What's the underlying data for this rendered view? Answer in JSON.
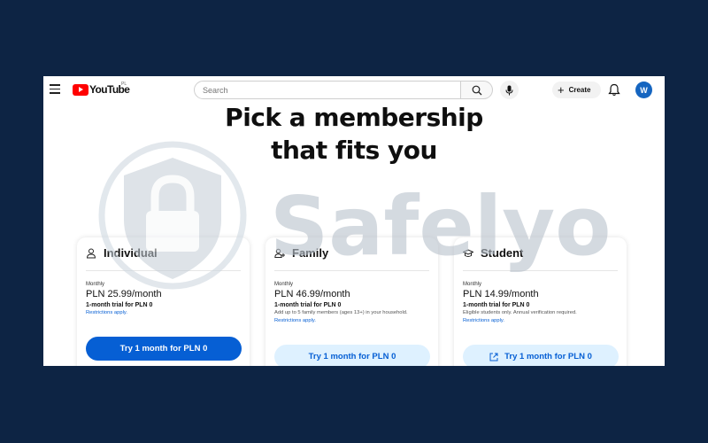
{
  "topbar": {
    "logo_text": "YouTube",
    "region": "PL",
    "search_placeholder": "Search",
    "create_label": "Create",
    "avatar_initial": "W"
  },
  "heading": {
    "line1": "Pick a membership",
    "line2": "that fits you"
  },
  "plans": [
    {
      "title": "Individual",
      "icon": "person-icon",
      "period": "Monthly",
      "price": "PLN 25.99/month",
      "trial": "1-month trial for PLN 0",
      "note": "",
      "restrictions": "Restrictions apply.",
      "button": "Try 1 month for PLN 0"
    },
    {
      "title": "Family",
      "icon": "family-icon",
      "period": "Monthly",
      "price": "PLN 46.99/month",
      "trial": "1-month trial for PLN 0",
      "note": "Add up to 5 family members (ages 13+) in your household.",
      "restrictions": "Restrictions apply.",
      "button": "Try 1 month for PLN 0"
    },
    {
      "title": "Student",
      "icon": "graduation-cap-icon",
      "period": "Monthly",
      "price": "PLN 14.99/month",
      "trial": "1-month trial for PLN 0",
      "note": "Eligible students only. Annual verification required.",
      "restrictions": "Restrictions apply.",
      "button": "Try 1 month for PLN 0"
    }
  ],
  "watermark": {
    "text": "Safelyo"
  },
  "colors": {
    "background": "#0d2444",
    "accent": "#065fd4",
    "button_light": "#def1ff",
    "logo_red": "#ff0000"
  }
}
